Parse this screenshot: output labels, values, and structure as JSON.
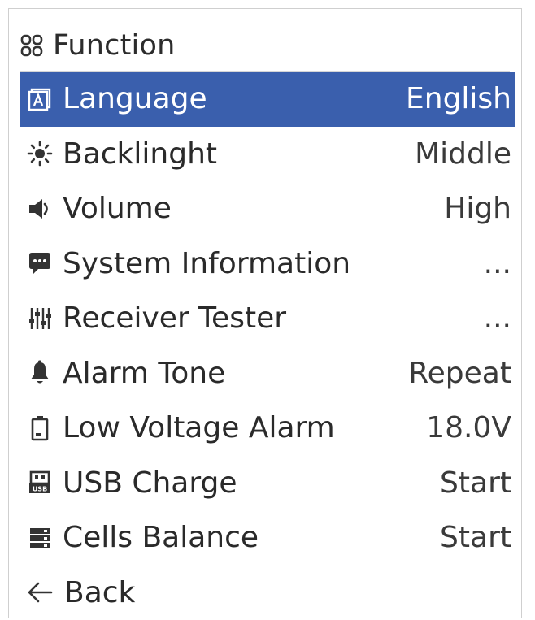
{
  "header": {
    "title": "Function",
    "icon": "grid-icon"
  },
  "colors": {
    "selection": "#3a5fad",
    "text": "#2a2a2a",
    "icon": "#333333",
    "divider": "#d6d6d6"
  },
  "menu": {
    "items": [
      {
        "icon": "language-icon",
        "label": "Language",
        "value": "English",
        "selected": true
      },
      {
        "icon": "backlight-icon",
        "label": "Backlinght",
        "value": "Middle"
      },
      {
        "icon": "volume-icon",
        "label": "Volume",
        "value": "High"
      },
      {
        "icon": "chat-icon",
        "label": "System Information",
        "value": "..."
      },
      {
        "icon": "sliders-icon",
        "label": "Receiver Tester",
        "value": "..."
      },
      {
        "icon": "bell-icon",
        "label": "Alarm Tone",
        "value": "Repeat"
      },
      {
        "icon": "battery-icon",
        "label": "Low Voltage Alarm",
        "value": "18.0V"
      },
      {
        "icon": "usb-icon",
        "label": "USB Charge",
        "value": "Start"
      },
      {
        "icon": "cells-icon",
        "label": "Cells Balance",
        "value": "Start"
      }
    ],
    "back": {
      "icon": "arrow-left-icon",
      "label": "Back"
    }
  }
}
